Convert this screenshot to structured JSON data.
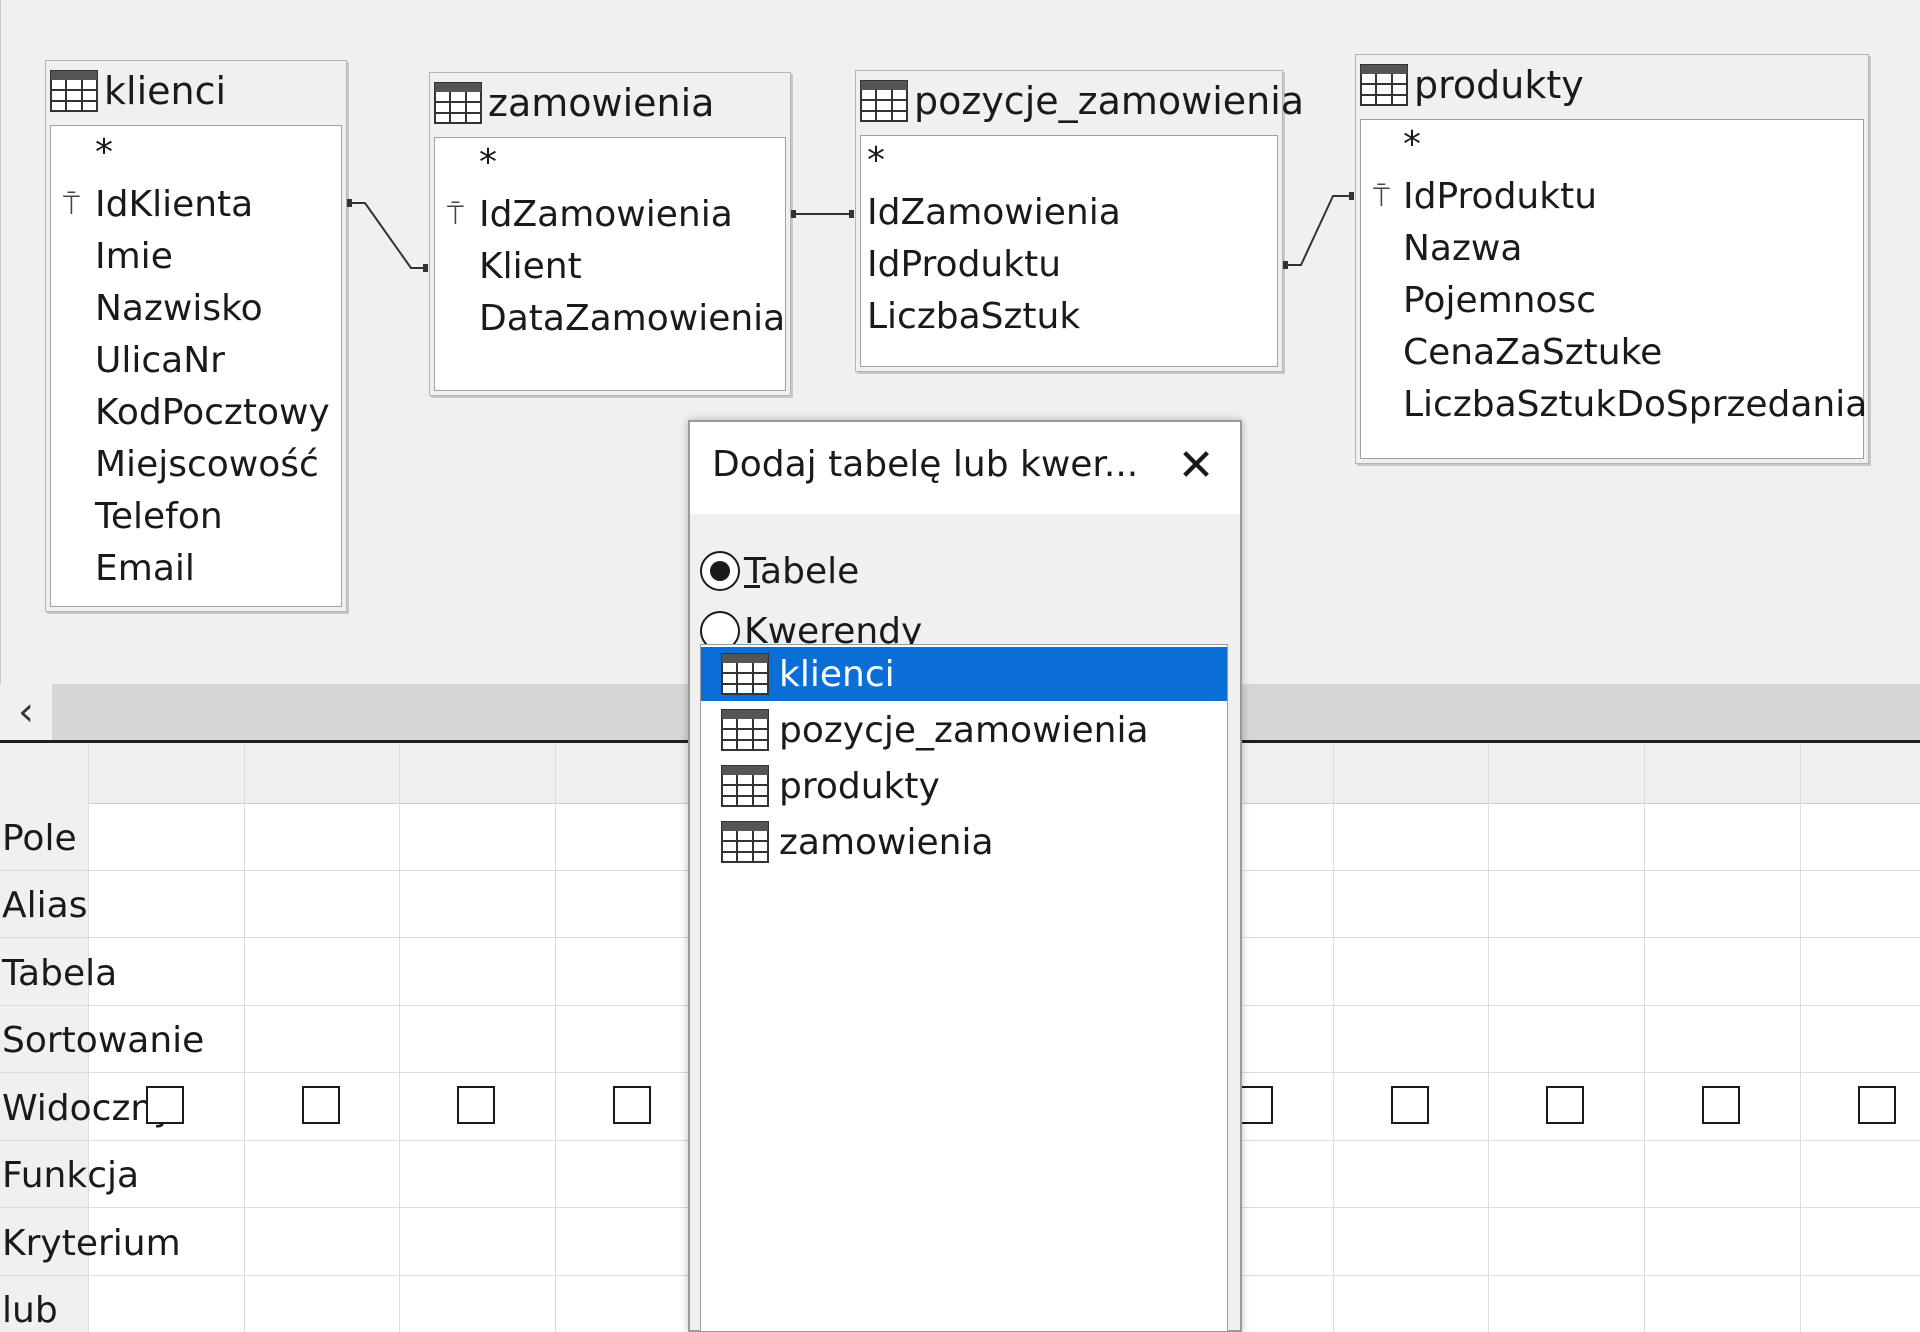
{
  "tables": [
    {
      "name": "klienci",
      "fields": [
        "*",
        "IdKlienta",
        "Imie",
        "Nazwisko",
        "UlicaNr",
        "KodPocztowy",
        "Miejscowość",
        "Telefon",
        "Email"
      ],
      "key_field": "IdKlienta"
    },
    {
      "name": "zamowienia",
      "fields": [
        "*",
        "IdZamowienia",
        "Klient",
        "DataZamowienia"
      ],
      "key_field": "IdZamowienia"
    },
    {
      "name": "pozycje_zamowienia",
      "fields": [
        "*",
        "IdZamowienia",
        "IdProduktu",
        "LiczbaSztuk"
      ],
      "key_field": ""
    },
    {
      "name": "produkty",
      "fields": [
        "*",
        "IdProduktu",
        "Nazwa",
        "Pojemnosc",
        "CenaZaSztuke",
        "LiczbaSztukDoSprzedania"
      ],
      "key_field": "IdProduktu"
    }
  ],
  "grid": {
    "row_labels": [
      "Pole",
      "Alias",
      "Tabela",
      "Sortowanie",
      "Widoczny",
      "Funkcja",
      "Kryterium",
      "lub"
    ]
  },
  "dialog": {
    "title": "Dodaj tabelę lub kwer...",
    "close_glyph": "✕",
    "radio_tables": "Tabele",
    "radio_queries": "Kwerendy",
    "radio_selected": "Tabele",
    "items": [
      "klienci",
      "pozycje_zamowienia",
      "produkty",
      "zamowienia"
    ],
    "selected_item": "klienci"
  },
  "scroll_left_glyph": "‹",
  "colors": {
    "selection": "#0a70d8",
    "background": "#f0f0f0"
  }
}
